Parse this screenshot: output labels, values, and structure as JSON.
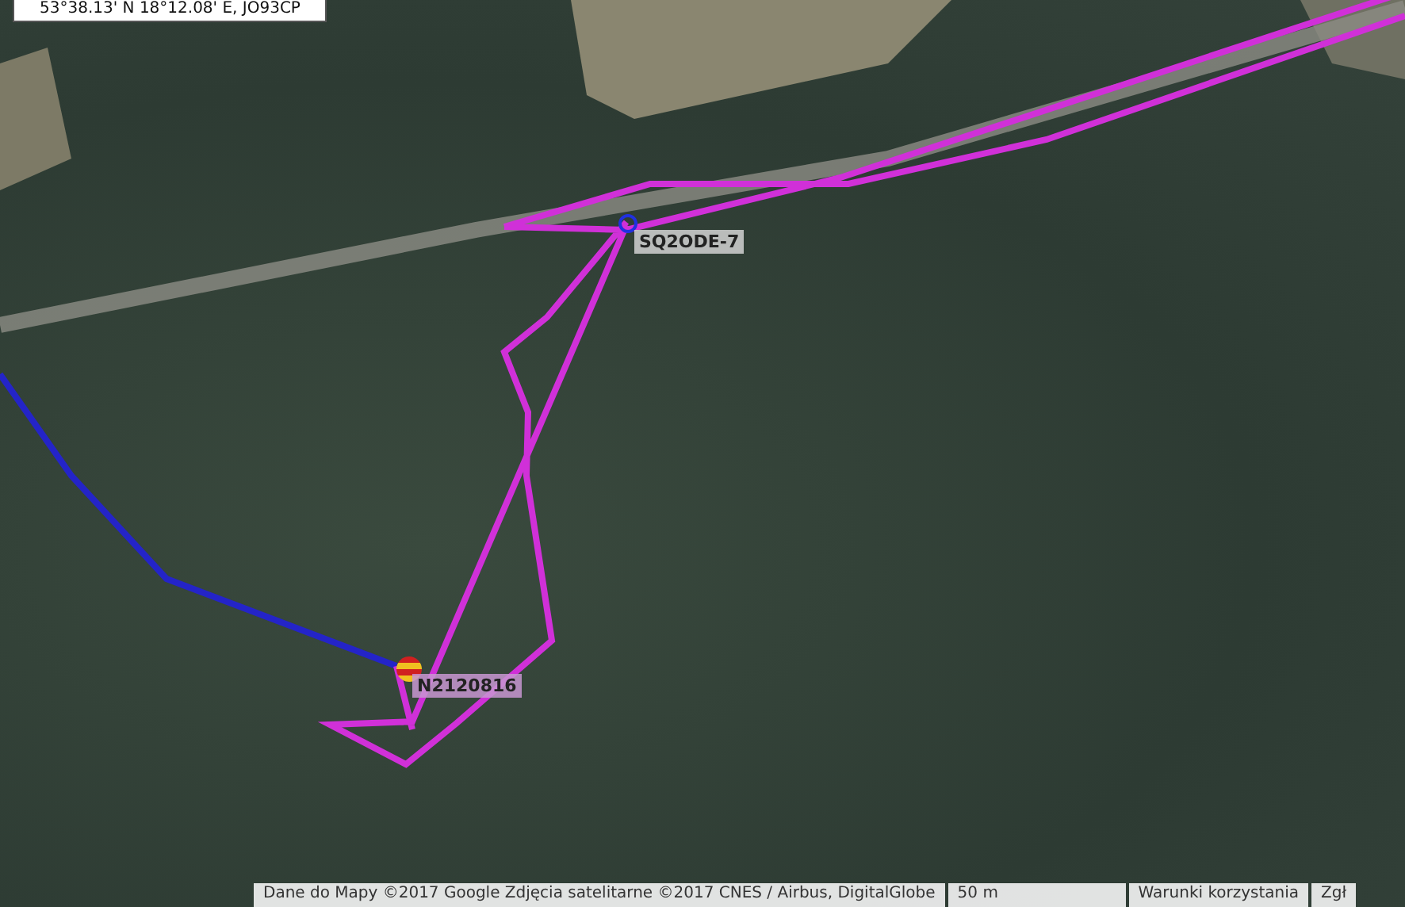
{
  "coordinates": "53°38.13' N 18°12.08' E, JO93CP",
  "stations": [
    {
      "callsign": "SQ2ODE-7",
      "kind": "car"
    },
    {
      "callsign": "N2120816",
      "kind": "balloon"
    }
  ],
  "attribution": {
    "map_data": "Dane do Mapy ©2017 Google Zdjęcia satelitarne ©2017 CNES / Airbus, DigitalGlobe",
    "scale": "50 m",
    "terms": "Warunki korzystania",
    "report": "Zgł"
  }
}
